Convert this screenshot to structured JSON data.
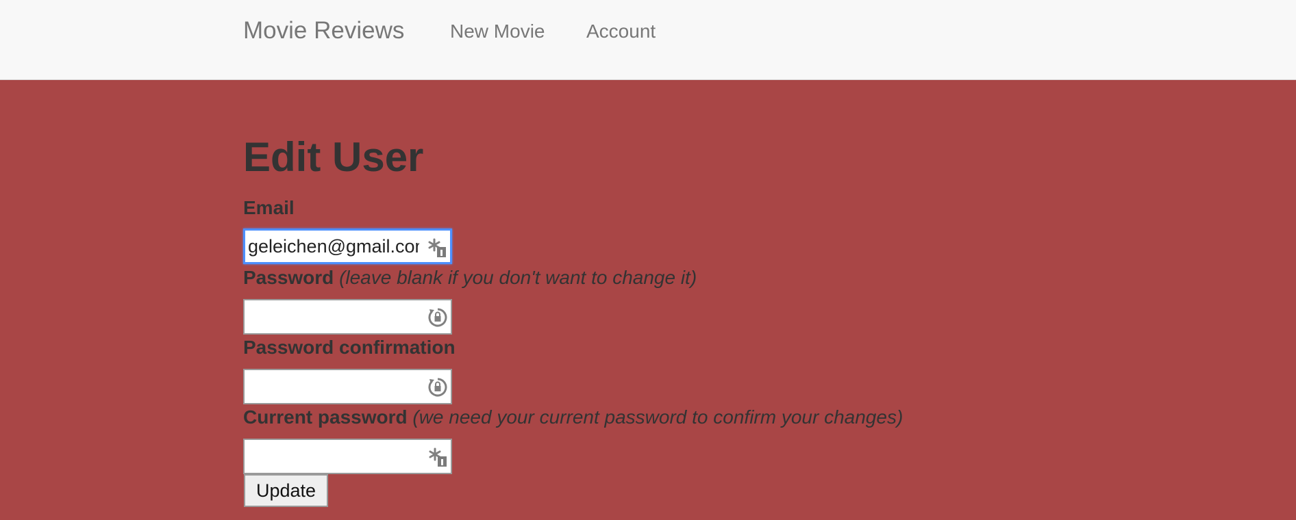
{
  "navbar": {
    "brand": "Movie Reviews",
    "links": [
      {
        "label": "New Movie"
      },
      {
        "label": "Account"
      }
    ]
  },
  "page": {
    "title": "Edit User"
  },
  "form": {
    "email": {
      "label": "Email",
      "value": "geleichen@gmail.com"
    },
    "password": {
      "label": "Password",
      "hint": "(leave blank if you don't want to change it)",
      "value": ""
    },
    "password_confirmation": {
      "label": "Password confirmation",
      "value": ""
    },
    "current_password": {
      "label": "Current password",
      "hint": "(we need your current password to confirm your changes)",
      "value": ""
    },
    "submit_label": "Update"
  },
  "icons": {
    "email_field_icon": "password-manager-key-icon",
    "password_field_icon": "password-generator-icon",
    "confirm_field_icon": "password-generator-icon",
    "current_field_icon": "password-manager-key-icon"
  },
  "colors": {
    "page_background": "#a94646",
    "navbar_background": "#f8f8f8",
    "nav_text": "#777777",
    "body_text": "#333333",
    "focus_ring": "#4d90fe"
  }
}
